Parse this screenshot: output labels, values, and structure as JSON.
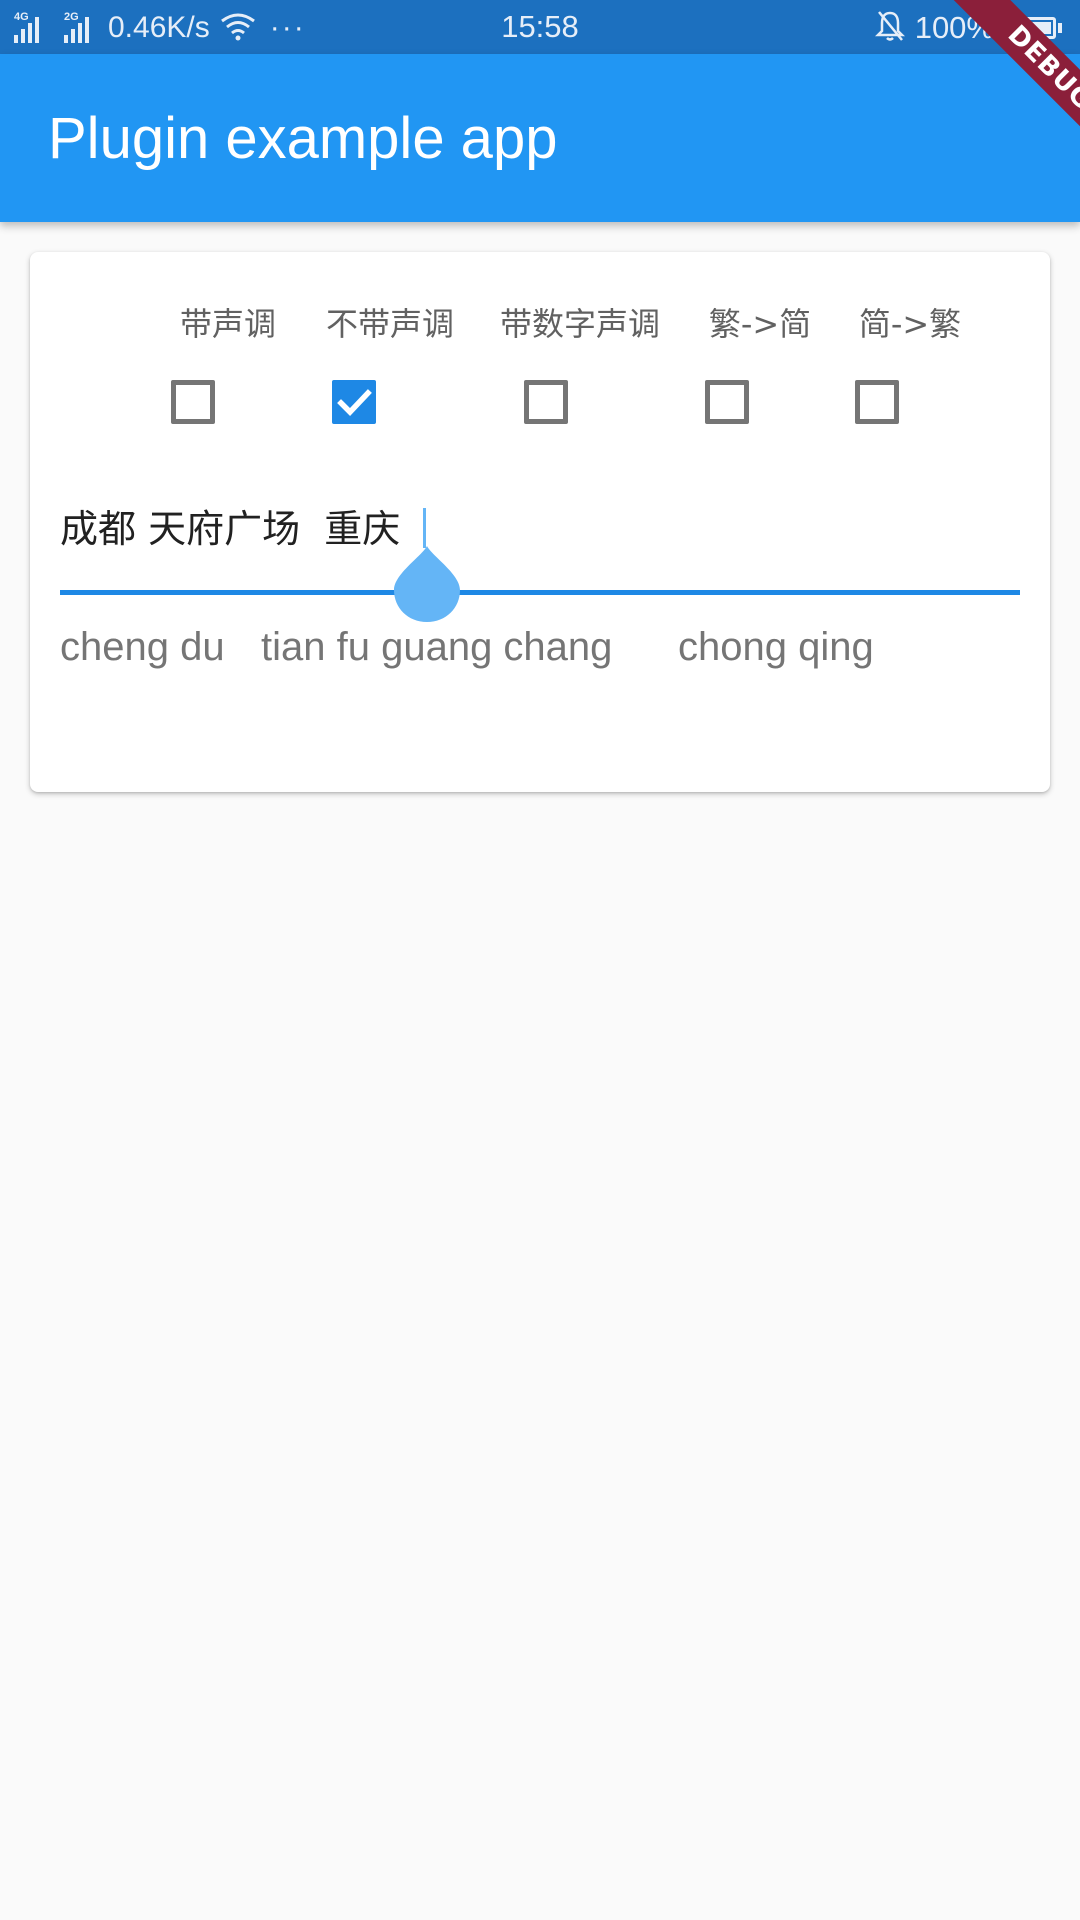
{
  "status_bar": {
    "network_1": "4G",
    "network_2": "2G",
    "speed": "0.46K/s",
    "more": "···",
    "time": "15:58",
    "battery": "100%"
  },
  "app_bar": {
    "title": "Plugin example app",
    "debug_banner": "DEBUG"
  },
  "options": [
    {
      "label": "带声调",
      "checked": false
    },
    {
      "label": "不带声调",
      "checked": true
    },
    {
      "label": "带数字声调",
      "checked": false
    },
    {
      "label": "繁->简",
      "checked": false
    },
    {
      "label": "简->繁",
      "checked": false
    }
  ],
  "input": {
    "value": "成都 天府广场  重庆"
  },
  "result": {
    "segments": [
      "cheng du",
      "tian fu guang chang",
      "chong qing"
    ]
  },
  "colors": {
    "primary": "#2196f3",
    "status_bar": "#1c70bf",
    "accent": "#1e88e5",
    "handle": "#64b5f6",
    "debug": "#8b1f3a"
  }
}
